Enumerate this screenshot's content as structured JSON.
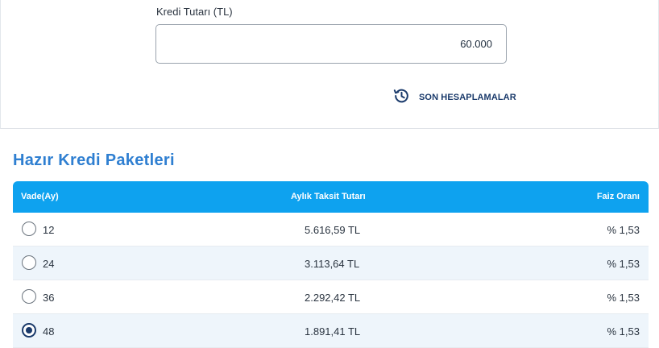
{
  "form": {
    "amount_label": "Kredi Tutarı (TL)",
    "amount_value": "60.000",
    "history_label": "SON HESAPLAMALAR"
  },
  "packages": {
    "title": "Hazır Kredi Paketleri",
    "columns": {
      "term": "Vade(Ay)",
      "installment": "Aylık Taksit Tutarı",
      "rate": "Faiz Oranı"
    },
    "rows": [
      {
        "term": "12",
        "installment": "5.616,59 TL",
        "rate": "% 1,53",
        "selected": false
      },
      {
        "term": "24",
        "installment": "3.113,64 TL",
        "rate": "% 1,53",
        "selected": false
      },
      {
        "term": "36",
        "installment": "2.292,42 TL",
        "rate": "% 1,53",
        "selected": false
      },
      {
        "term": "48",
        "installment": "1.891,41 TL",
        "rate": "% 1,53",
        "selected": true
      }
    ]
  },
  "colors": {
    "header_bg": "#0ea2ef",
    "title": "#2f7fd1",
    "accent": "#1a3a6b"
  },
  "icons": {
    "history": "history-clock-icon"
  }
}
